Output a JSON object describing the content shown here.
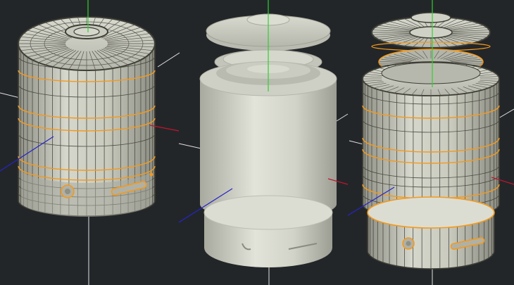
{
  "viewport": {
    "background": "#232629",
    "models": [
      {
        "id": "left",
        "shading": "wireframe-on-shaded",
        "exploded": false
      },
      {
        "id": "center",
        "shading": "shaded",
        "exploded": true
      },
      {
        "id": "right",
        "shading": "wireframe-on-shaded",
        "exploded": true
      }
    ],
    "colors": {
      "surface": "#c8c9bd",
      "surface_light": "#d4d5ca",
      "surface_dark": "#9b9c91",
      "wire": "#3e3e36",
      "selection": "#f39a1c",
      "axis_x": "#c2152c",
      "axis_y": "#2fd12f",
      "axis_z": "#2424c8",
      "grid": "#e0e0e0"
    }
  }
}
